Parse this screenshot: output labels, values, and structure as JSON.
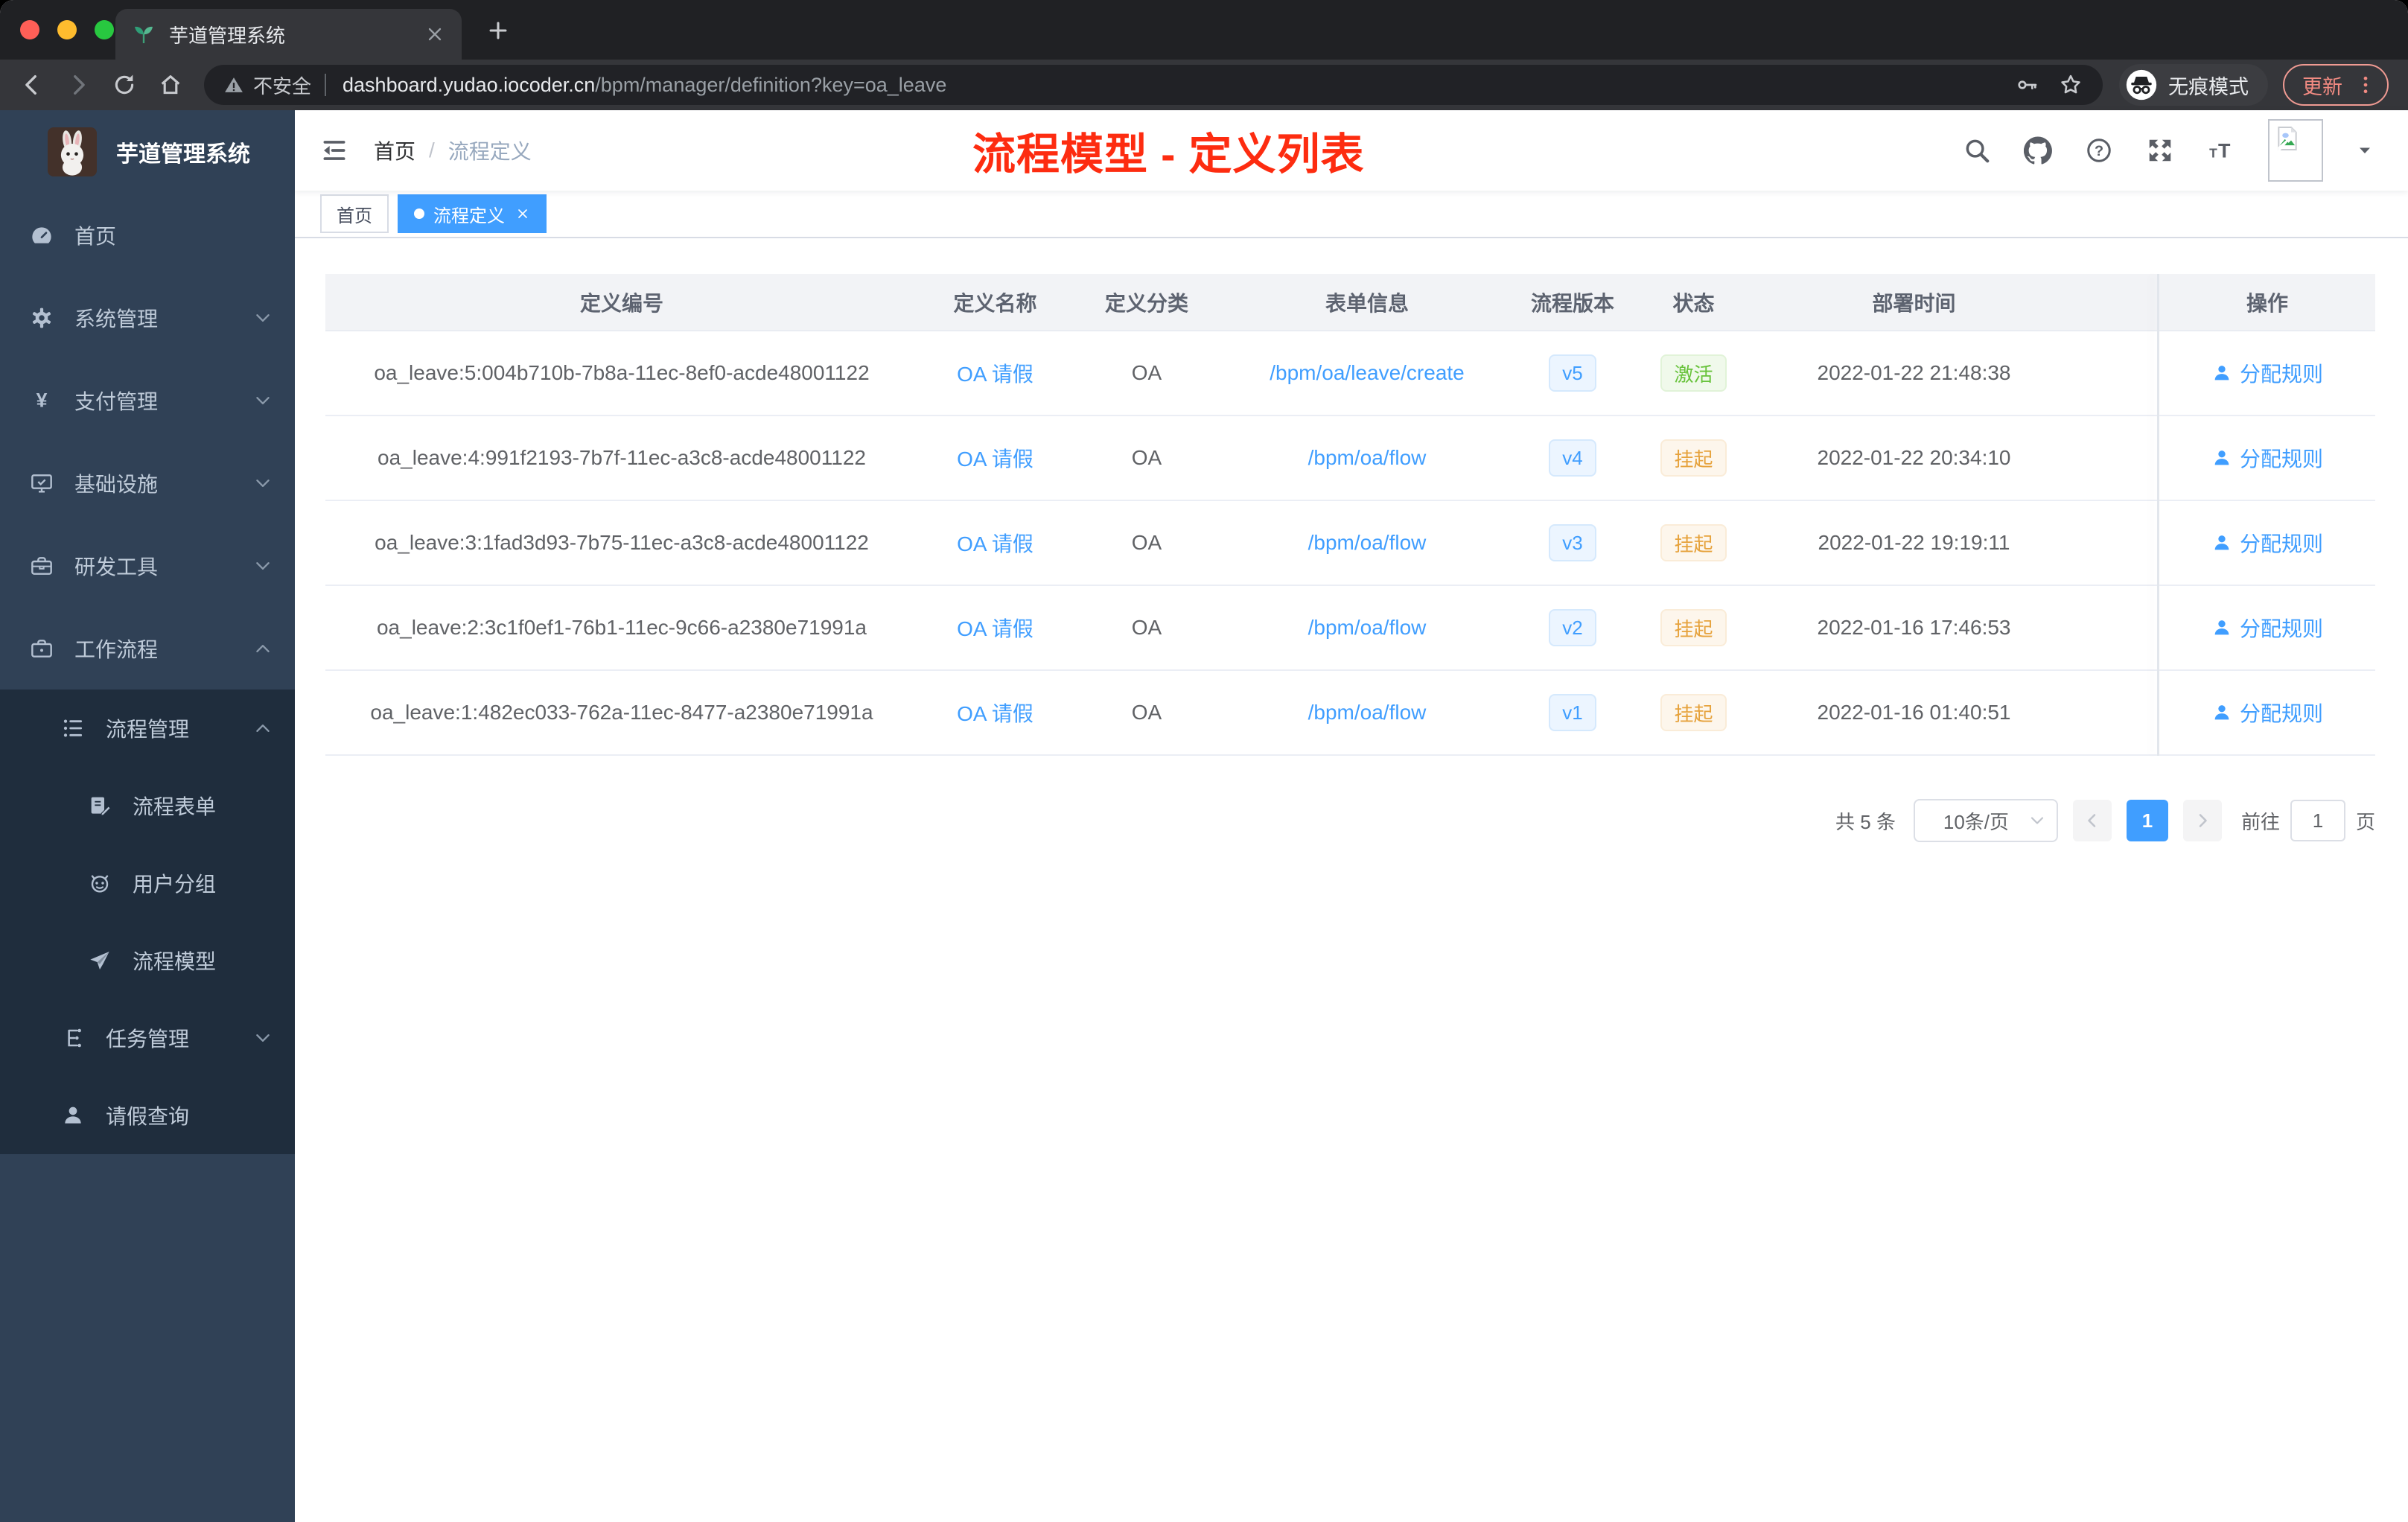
{
  "browser": {
    "tab_title": "芋道管理系统",
    "security_label": "不安全",
    "url_host": "dashboard.yudao.iocoder.cn",
    "url_path": "/bpm/manager/definition?key=oa_leave",
    "incognito_label": "无痕模式",
    "update_label": "更新"
  },
  "sidebar": {
    "logo_title": "芋道管理系统",
    "menu": [
      {
        "key": "home",
        "label": "首页",
        "icon": "dashboard",
        "level": 1,
        "group": "top",
        "chevron": null
      },
      {
        "key": "system",
        "label": "系统管理",
        "icon": "gear",
        "level": 1,
        "group": "top",
        "chevron": "down"
      },
      {
        "key": "payment",
        "label": "支付管理",
        "icon": "yen",
        "level": 1,
        "group": "top",
        "chevron": "down"
      },
      {
        "key": "infra",
        "label": "基础设施",
        "icon": "monitor",
        "level": 1,
        "group": "top",
        "chevron": "down"
      },
      {
        "key": "devtools",
        "label": "研发工具",
        "icon": "toolbox",
        "level": 1,
        "group": "top",
        "chevron": "down"
      },
      {
        "key": "workflow",
        "label": "工作流程",
        "icon": "briefcase",
        "level": 1,
        "group": "top",
        "chevron": "up"
      },
      {
        "key": "process-manage",
        "label": "流程管理",
        "icon": "list-tree",
        "level": 2,
        "group": "sub",
        "chevron": "up"
      },
      {
        "key": "process-form",
        "label": "流程表单",
        "icon": "form-edit",
        "level": 3,
        "group": "sub",
        "chevron": null
      },
      {
        "key": "user-group",
        "label": "用户分组",
        "icon": "robot",
        "level": 3,
        "group": "sub",
        "chevron": null
      },
      {
        "key": "process-model",
        "label": "流程模型",
        "icon": "paper-plane",
        "level": 3,
        "group": "sub",
        "chevron": null
      },
      {
        "key": "task-manage",
        "label": "任务管理",
        "icon": "task-tree",
        "level": 2,
        "group": "sub",
        "chevron": "down"
      },
      {
        "key": "leave-query",
        "label": "请假查询",
        "icon": "user",
        "level": 2,
        "group": "sub",
        "chevron": null
      }
    ]
  },
  "navbar": {
    "breadcrumb": {
      "home": "首页",
      "separator": "/",
      "current": "流程定义"
    },
    "annotation": "流程模型 - 定义列表"
  },
  "tags": [
    {
      "label": "首页",
      "active": false,
      "closable": false
    },
    {
      "label": "流程定义",
      "active": true,
      "closable": true
    }
  ],
  "table": {
    "columns": [
      "定义编号",
      "定义名称",
      "定义分类",
      "表单信息",
      "流程版本",
      "状态",
      "部署时间",
      "操作"
    ],
    "rows": [
      {
        "id": "oa_leave:5:004b710b-7b8a-11ec-8ef0-acde48001122",
        "name": "OA 请假",
        "category": "OA",
        "form": "/bpm/oa/leave/create",
        "version": "v5",
        "status": "激活",
        "status_type": "success",
        "time": "2022-01-22 21:48:38",
        "action": "分配规则"
      },
      {
        "id": "oa_leave:4:991f2193-7b7f-11ec-a3c8-acde48001122",
        "name": "OA 请假",
        "category": "OA",
        "form": "/bpm/oa/flow",
        "version": "v4",
        "status": "挂起",
        "status_type": "warning",
        "time": "2022-01-22 20:34:10",
        "action": "分配规则"
      },
      {
        "id": "oa_leave:3:1fad3d93-7b75-11ec-a3c8-acde48001122",
        "name": "OA 请假",
        "category": "OA",
        "form": "/bpm/oa/flow",
        "version": "v3",
        "status": "挂起",
        "status_type": "warning",
        "time": "2022-01-22 19:19:11",
        "action": "分配规则"
      },
      {
        "id": "oa_leave:2:3c1f0ef1-76b1-11ec-9c66-a2380e71991a",
        "name": "OA 请假",
        "category": "OA",
        "form": "/bpm/oa/flow",
        "version": "v2",
        "status": "挂起",
        "status_type": "warning",
        "time": "2022-01-16 17:46:53",
        "action": "分配规则"
      },
      {
        "id": "oa_leave:1:482ec033-762a-11ec-8477-a2380e71991a",
        "name": "OA 请假",
        "category": "OA",
        "form": "/bpm/oa/flow",
        "version": "v1",
        "status": "挂起",
        "status_type": "warning",
        "time": "2022-01-16 01:40:51",
        "action": "分配规则"
      }
    ]
  },
  "pagination": {
    "total_label": "共 5 条",
    "page_size": "10条/页",
    "current_page": "1",
    "goto_label": "前往",
    "goto_value": "1",
    "page_unit": "页"
  },
  "colors": {
    "accent": "#409eff",
    "annotation": "#fd2c10",
    "status_active": "#67c23a",
    "status_suspended": "#e6a23c",
    "sidebar_bg": "#304156",
    "submenu_bg": "#1f2d3d"
  }
}
